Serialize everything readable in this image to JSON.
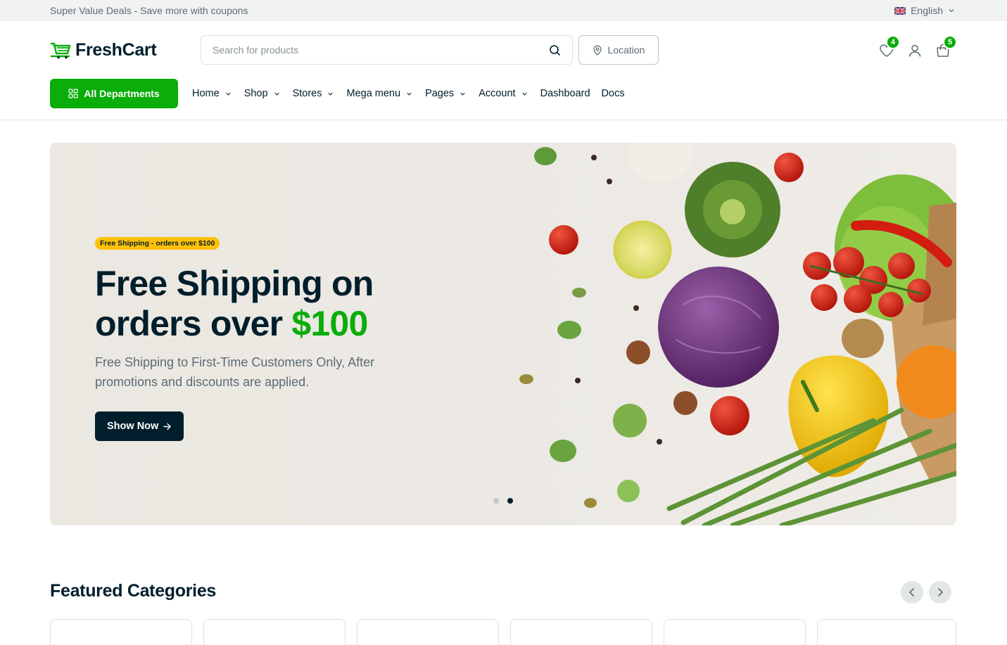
{
  "topbar": {
    "deal_text": "Super Value Deals - Save more with coupons",
    "language": "English"
  },
  "header": {
    "brand": "FreshCart",
    "search_placeholder": "Search for products",
    "location_label": "Location",
    "wishlist_count": "4",
    "cart_count": "5"
  },
  "nav": {
    "departments_label": "All Departments",
    "items": [
      {
        "label": "Home",
        "dropdown": true
      },
      {
        "label": "Shop",
        "dropdown": true
      },
      {
        "label": "Stores",
        "dropdown": true
      },
      {
        "label": "Mega menu",
        "dropdown": true
      },
      {
        "label": "Pages",
        "dropdown": true
      },
      {
        "label": "Account",
        "dropdown": true
      },
      {
        "label": "Dashboard",
        "dropdown": false
      },
      {
        "label": "Docs",
        "dropdown": false
      }
    ]
  },
  "hero": {
    "badge": "Free Shipping - orders over $100",
    "title_line1": "Free Shipping on",
    "title_line2_prefix": "orders over ",
    "title_highlight": "$100",
    "description": "Free Shipping to First-Time Customers Only, After promotions and discounts are applied.",
    "cta_label": "Show Now",
    "carousel_active_index": 1,
    "carousel_count": 2
  },
  "featured": {
    "title": "Featured Categories"
  },
  "colors": {
    "brand_green": "#0aad0a",
    "dark": "#001e2b",
    "badge_yellow": "#ffc107"
  }
}
